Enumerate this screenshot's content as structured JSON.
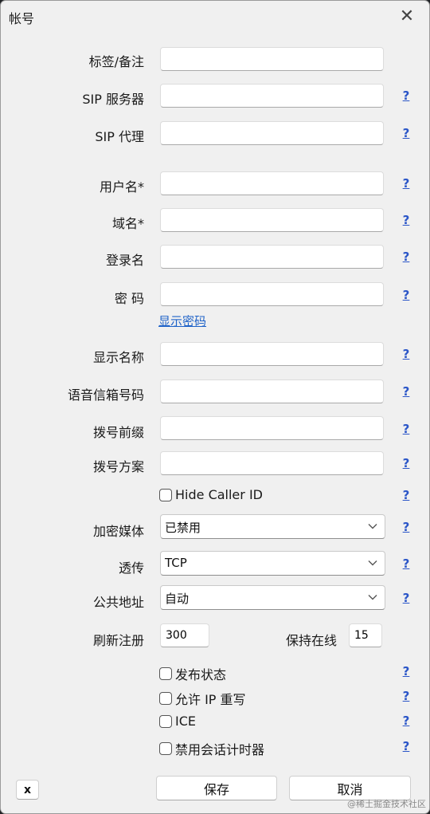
{
  "window": {
    "title": "帐号"
  },
  "fields": {
    "tag": {
      "label": "标签/备注",
      "value": ""
    },
    "sip_server": {
      "label": "SIP 服务器",
      "value": ""
    },
    "sip_proxy": {
      "label": "SIP 代理",
      "value": ""
    },
    "username": {
      "label": "用户名*",
      "value": ""
    },
    "domain": {
      "label": "域名*",
      "value": ""
    },
    "login": {
      "label": "登录名",
      "value": ""
    },
    "password": {
      "label": "密 码",
      "value": ""
    },
    "display_name": {
      "label": "显示名称",
      "value": ""
    },
    "voicemail": {
      "label": "语音信箱号码",
      "value": ""
    },
    "dial_prefix": {
      "label": "拨号前缀",
      "value": ""
    },
    "dial_plan": {
      "label": "拨号方案",
      "value": ""
    }
  },
  "show_password_link": "显示密码",
  "help_mark": "?",
  "hide_caller_id": {
    "label": "Hide Caller ID",
    "checked": false
  },
  "selects": {
    "encryption": {
      "label": "加密媒体",
      "value": "已禁用"
    },
    "transport": {
      "label": "透传",
      "value": "TCP"
    },
    "public_address": {
      "label": "公共地址",
      "value": "自动"
    }
  },
  "register_refresh": {
    "label": "刷新注册",
    "value": "300"
  },
  "keep_alive": {
    "label": "保持在线",
    "value": "15"
  },
  "checkboxes": [
    {
      "label": "发布状态",
      "checked": false
    },
    {
      "label": "允许 IP 重写",
      "checked": false
    },
    {
      "label": "ICE",
      "checked": false
    },
    {
      "label": "禁用会话计时器",
      "checked": false
    }
  ],
  "buttons": {
    "x_label": "x",
    "save": "保存",
    "cancel": "取消"
  },
  "watermark": "@稀土掘金技术社区"
}
